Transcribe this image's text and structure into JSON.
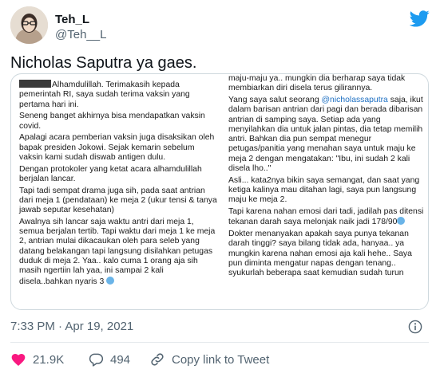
{
  "header": {
    "display_name": "Teh_L",
    "handle": "@Teh__L"
  },
  "tweet": {
    "text": "Nicholas Saputra ya gaes."
  },
  "image": {
    "left_paragraphs": [
      "Alhamdulillah. Terimakasih kepada pemerintah RI, saya sudah terima vaksin yang pertama hari ini.",
      "Seneng banget akhirnya bisa mendapatkan vaksin covid.",
      "Apalagi acara pemberian vaksin juga disaksikan oleh bapak presiden Jokowi. Sejak kemarin sebelum vaksin kami sudah diswab antigen dulu.",
      "Dengan protokoler yang ketat acara alhamdulillah berjalan lancar.",
      "Tapi tadi sempat drama juga sih, pada saat antrian dari meja 1 (pendataan) ke meja 2 (ukur tensi & tanya jawab seputar kesehatan)",
      "Awalnya sih lancar saja waktu antri dari meja 1, semua berjalan tertib. Tapi waktu dari meja 1 ke meja 2, antrian mulai dikacaukan oleh para seleb yang datang belakangan tapi langsung disilahkan petugas duduk di meja 2. Yaa.. kalo cuma 1 orang aja sih masih ngertiin lah yaa, ini sampai 2 kali disela..bahkan nyaris 3"
    ],
    "right_intro": "maju-maju ya.. mungkin dia berharap saya tidak membiarkan diri disela terus gilirannya.",
    "right_mention_prefix": "Yang saya salut seorang",
    "right_mention": "@nicholassaputra",
    "right_mention_suffix": "saja, ikut dalam barisan antrian dari pagi dan berada dibarisan antrian di samping saya. Setiap ada yang menyilahkan dia untuk jalan pintas, dia tetap memilih antri.  Bahkan dia pun sempat menegur petugas/panitia yang menahan saya untuk maju ke meja 2 dengan mengatakan: \"Ibu, ini sudah 2 kali disela lho..\"",
    "right_paragraphs": [
      "Asli... kata2nya bikin saya semangat, dan saat yang ketiga kalinya mau ditahan lagi, saya pun langsung maju ke meja 2.",
      "Tapi karena nahan emosi dari tadi, jadilah pas ditensi tekanan darah saya melonjak naik jadi 178/90",
      "Dokter menanyakan apakah saya punya tekanan darah tinggi? saya bilang tidak ada, hanyaa.. ya mungkin karena nahan emosi aja kali hehe..  Saya pun diminta mengatur napas dengan tenang.. syukurlah beberapa saat kemudian sudah turun"
    ]
  },
  "meta": {
    "timestamp": "7:33 PM · Apr 19, 2021"
  },
  "actions": {
    "likes": "21.9K",
    "replies": "494",
    "share_label": "Copy link to Tweet"
  },
  "colors": {
    "brand": "#1d9bf0",
    "like": "#f91880",
    "secondary_text": "#536471"
  }
}
